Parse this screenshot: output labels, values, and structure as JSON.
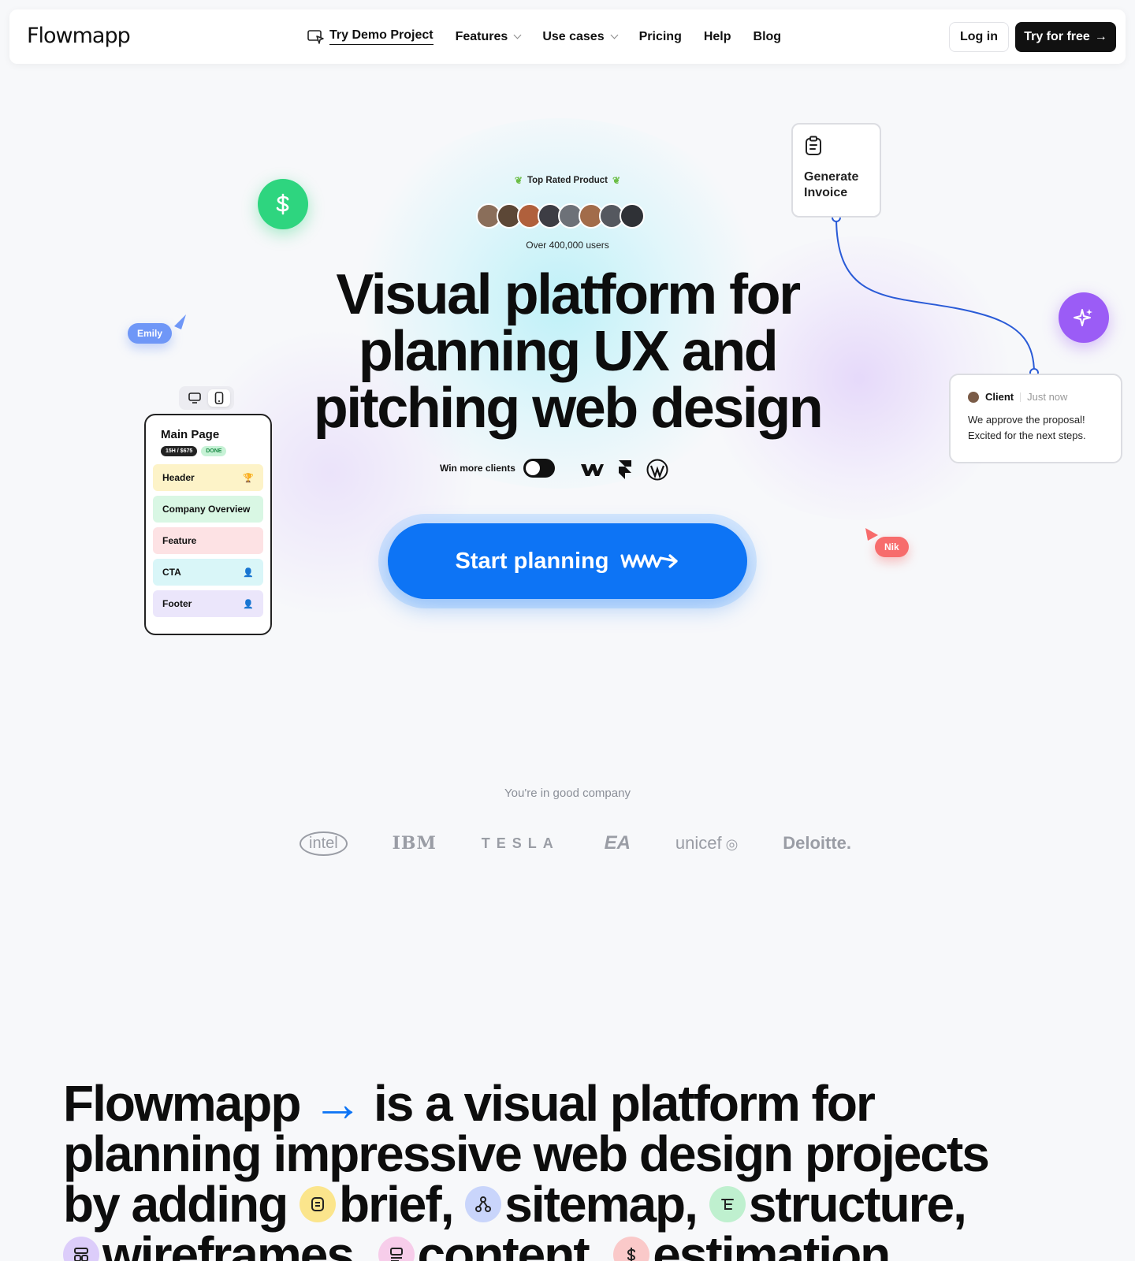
{
  "nav": {
    "logo": "Flowmapp",
    "demo": "Try Demo Project",
    "features": "Features",
    "use_cases": "Use cases",
    "pricing": "Pricing",
    "help": "Help",
    "blog": "Blog",
    "login": "Log in",
    "try_free": "Try for free"
  },
  "hero": {
    "top_rated": "Top Rated Product",
    "users": "Over 400,000 users",
    "title_line1": "Visual platform for",
    "title_line2": "planning UX and",
    "title_line3": "pitching web design",
    "win_label": "Win more clients",
    "cta": "Start planning"
  },
  "floating": {
    "emily": "Emily",
    "nik": "Nik",
    "invoice_line1": "Generate",
    "invoice_line2": "Invoice",
    "client_name": "Client",
    "client_time": "Just now",
    "client_msg_line1": "We approve the proposal!",
    "client_msg_line2": "Excited for the next steps."
  },
  "phone": {
    "title": "Main Page",
    "badge_time": "15H / $675",
    "badge_status": "DONE",
    "rows": [
      {
        "label": "Header",
        "color": "#fdf3c8"
      },
      {
        "label": "Company Overview",
        "color": "#d9f7e4"
      },
      {
        "label": "Feature",
        "color": "#fde2e4"
      },
      {
        "label": "CTA",
        "color": "#d9f6f8"
      },
      {
        "label": "Footer",
        "color": "#ebe6fb"
      }
    ]
  },
  "company": {
    "label": "You're in good company",
    "logos": [
      "intel",
      "IBM",
      "TESLA",
      "EA",
      "unicef",
      "Deloitte."
    ]
  },
  "about": {
    "brand": "Flowmapp",
    "text1": "is a visual platform for",
    "text2": "planning impressive web design projects",
    "text3": "by adding",
    "w_brief": "brief,",
    "w_sitemap": "sitemap,",
    "w_structure": "structure,",
    "w_wireframes": "wireframes,",
    "w_content": "content,",
    "w_estimation": "estimation"
  },
  "colors": {
    "accent": "#0d74f5",
    "green": "#2ed57f",
    "purple": "#9b5cf6"
  }
}
